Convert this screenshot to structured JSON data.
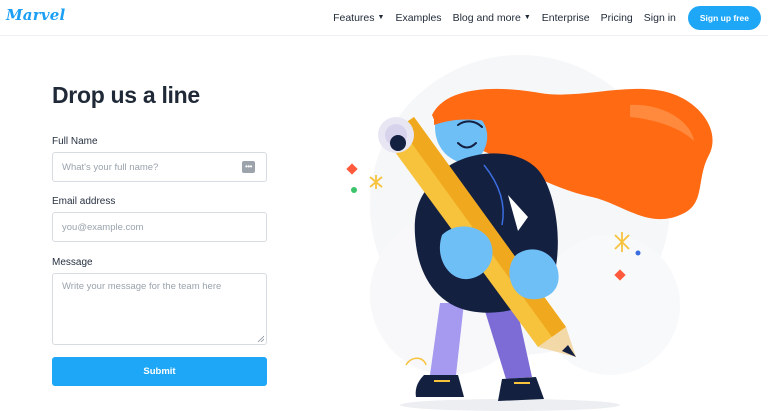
{
  "brand": {
    "logo_text": "Marvel"
  },
  "nav": {
    "items": [
      {
        "label": "Features",
        "has_dropdown": true
      },
      {
        "label": "Examples",
        "has_dropdown": false
      },
      {
        "label": "Blog and more",
        "has_dropdown": true
      },
      {
        "label": "Enterprise",
        "has_dropdown": false
      },
      {
        "label": "Pricing",
        "has_dropdown": false
      },
      {
        "label": "Sign in",
        "has_dropdown": false
      }
    ],
    "cta_label": "Sign up free",
    "chevron_glyph": "▼"
  },
  "form": {
    "title": "Drop us a line",
    "full_name": {
      "label": "Full Name",
      "placeholder": "What's your full name?",
      "icon": "more-dots-icon",
      "icon_glyph": "•••"
    },
    "email": {
      "label": "Email address",
      "placeholder": "you@example.com"
    },
    "message": {
      "label": "Message",
      "placeholder": "Write your message for the team here"
    },
    "submit_label": "Submit"
  },
  "colors": {
    "accent": "#1ea7f7",
    "text": "#1f2937",
    "hair": "#ff6a13",
    "skin": "#6fbff7",
    "jacket": "#142040",
    "pencil": "#f7c23c",
    "pants": "#8c7dd6"
  },
  "illustration": {
    "subject": "woman with orange hair carrying a giant pencil"
  }
}
